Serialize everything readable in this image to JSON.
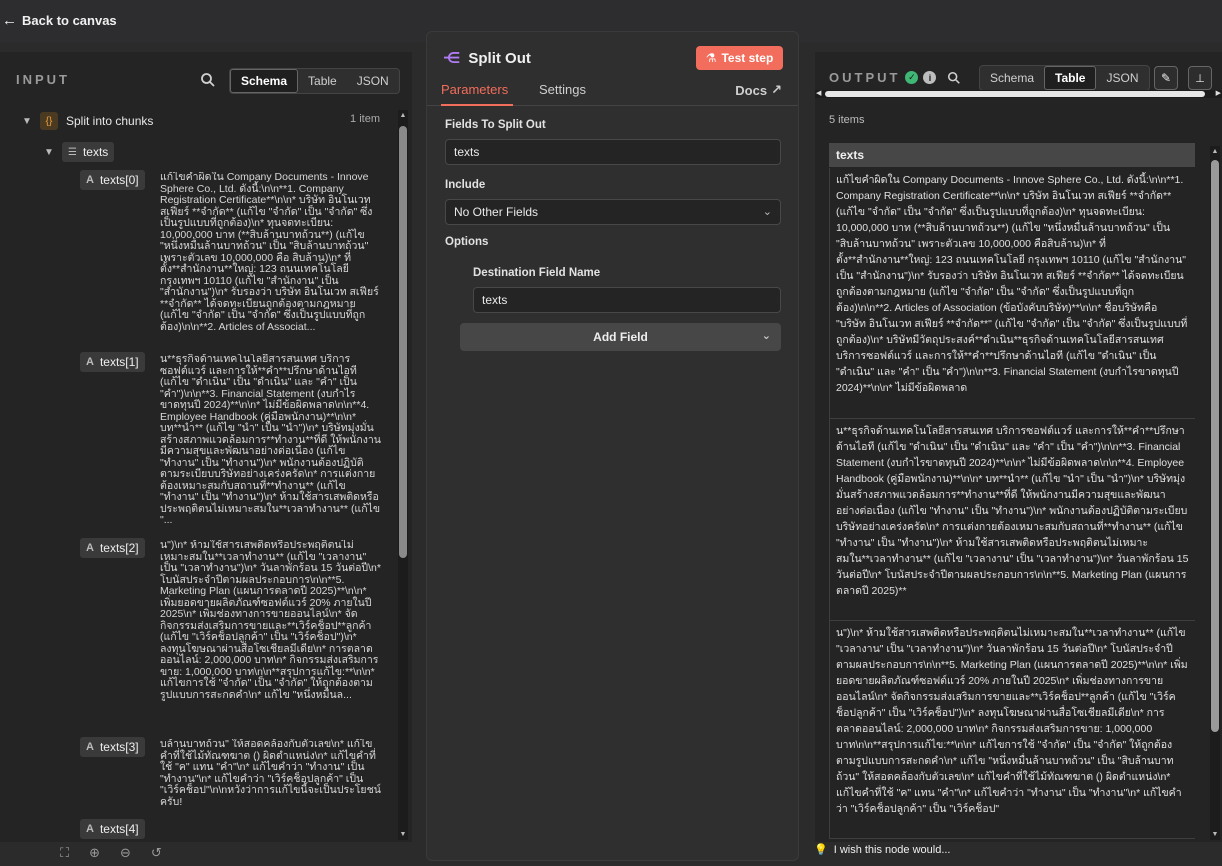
{
  "topbar": {
    "back_label": "Back to canvas"
  },
  "input": {
    "title": "INPUT",
    "views": [
      "Schema",
      "Table",
      "JSON"
    ],
    "active_view": "Schema",
    "root_label": "Split into chunks",
    "root_count": "1 item",
    "array_label": "texts",
    "entries": [
      {
        "key": "texts[0]",
        "value": "แก้ไขคำผิดใน Company Documents - Innove Sphere Co., Ltd. ดังนี้:\\n\\n**1. Company Registration Certificate**\\n\\n* บริษัท อินโนเวท สเฟียร์ **จำกัด** (แก้ไข \"จำกัด\" เป็น \"จำกัด\" ซึ่งเป็นรูปแบบที่ถูกต้อง)\\n* ทุนจดทะเบียน: 10,000,000 บาท (**สิบล้านบาทถ้วน**) (แก้ไข \"หนึ่งหมื่นล้านบาทถ้วน\" เป็น \"สิบล้านบาทถ้วน\" เพราะตัวเลข 10,000,000 คือ สิบล้าน)\\n* ที่ตั้ง**สำนักงาน**ใหญ่: 123 ถนนเทคโนโลยี กรุงเทพฯ 10110 (แก้ไข \"สำนักงาน\" เป็น \"สำนักงาน\")\\n* รับรองว่า บริษัท อินโนเวท สเฟียร์ **จำกัด** ได้จดทะเบียนถูกต้องตามกฎหมาย (แก้ไข \"จำกัด\" เป็น \"จำกัด\" ซึ่งเป็นรูปแบบที่ถูกต้อง)\\n\\n**2. Articles of Associat..."
      },
      {
        "key": "texts[1]",
        "value": "น**ธุรกิจด้านเทคโนโลยีสารสนเทศ บริการซอฟต์แวร์ และการให้**คำ**ปรึกษาด้านไอที (แก้ไข \"ดำเนิน\" เป็น \"ดำเนิน\" และ \"คำ\" เป็น \"คำ\")\\n\\n**3. Financial Statement (งบกำไรขาดทุนปี 2024)**\\n\\n* ไม่มีข้อผิดพลาด\\n\\n**4. Employee Handbook (คู่มือพนักงาน)**\\n\\n* บท**นำ** (แก้ไข \"นำ\" เป็น \"นำ\")\\n* บริษัทมุ่งมั่นสร้างสภาพแวดล้อมการ**ทำงาน**ที่ดี ให้พนักงานมีความสุขและพัฒนาอย่างต่อเนื่อง (แก้ไข \"ทำงาน\" เป็น \"ทำงาน\")\\n* พนักงานต้องปฏิบัติตามระเบียบบริษัทอย่างเคร่งครัด\\n* การแต่งกายต้องเหมาะสมกับสถานที่**ทำงาน** (แก้ไข \"ทำงาน\" เป็น \"ทำงาน\")\\n* ห้ามใช้สารเสพติดหรือประพฤติตนไม่เหมาะสมใน**เวลาทำงาน** (แก้ไข \"..."
      },
      {
        "key": "texts[2]",
        "value": "น\")\\n* ห้ามใช้สารเสพติดหรือประพฤติตนไม่เหมาะสมใน**เวลาทำงาน** (แก้ไข \"เวลางาน\" เป็น \"เวลาทำงาน\")\\n* วันลาพักร้อน 15 วันต่อปี\\n* โบนัสประจำปีตามผลประกอบการ\\n\\n**5. Marketing Plan (แผนการตลาดปี 2025)**\\n\\n* เพิ่มยอดขายผลิตภัณฑ์ซอฟต์แวร์ 20% ภายในปี 2025\\n* เพิ่มช่องทางการขายออนไลน์\\n* จัดกิจกรรมส่งเสริมการขายและ**เวิร์คช็อป**ลูกค้า (แก้ไข \"เวิร์คช็อปลูกค้า\" เป็น \"เวิร์คช็อป\")\\n* ลงทุนโฆษณาผ่านสื่อโซเชียลมีเดีย\\n* การตลาดออนไลน์: 2,000,000 บาท\\n* กิจกรรมส่งเสริมการขาย: 1,000,000 บาท\\n\\n**สรุปการแก้ไข:**\\n\\n* แก้ไขการใช้ \"จำกัด\" เป็น \"จำกัด\" ให้ถูกต้องตามรูปแบบการสะกดคำ\\n* แก้ไข \"หนึ่งหมื่นล..."
      },
      {
        "key": "texts[3]",
        "value": "บล้านบาทถ้วน\" ให้สอดคล้องกับตัวเลข\\n* แก้ไขคำที่ใช้ไม้ทัณฑฆาต (ฺ) ผิดตำแหน่ง\\n* แก้ไขคำที่ใช้ \"ค\" แทน \"คำ\"\\n* แก้ไขคำว่า \"ทำงาน\" เป็น \"ทำงาน\"\\n* แก้ไขคำว่า \"เวิร์คช็อปลูกค้า\" เป็น \"เวิร์คช็อป\"\\n\\nหวังว่าการแก้ไขนี้จะเป็นประโยชน์ครับ!"
      },
      {
        "key": "texts[4]",
        "value": ""
      }
    ]
  },
  "node": {
    "title": "Split Out",
    "test_label": "Test step",
    "tabs": [
      "Parameters",
      "Settings"
    ],
    "active_tab": "Parameters",
    "docs_label": "Docs",
    "fields_label": "Fields To Split Out",
    "fields_value": "texts",
    "include_label": "Include",
    "include_value": "No Other Fields",
    "options_label": "Options",
    "dest_label": "Destination Field Name",
    "dest_value": "texts",
    "add_field_label": "Add Field",
    "accent": "#f26d5b"
  },
  "output": {
    "title": "OUTPUT",
    "views": [
      "Schema",
      "Table",
      "JSON"
    ],
    "active_view": "Table",
    "items_count": "5 items",
    "column": "texts",
    "rows": [
      "แก้ไขคำผิดใน Company Documents - Innove Sphere Co., Ltd. ดังนี้:\\n\\n**1. Company Registration Certificate**\\n\\n* บริษัท อินโนเวท สเฟียร์ **จำกัด** (แก้ไข \"จำกัด\" เป็น \"จำกัด\" ซึ่งเป็นรูปแบบที่ถูกต้อง)\\n* ทุนจดทะเบียน: 10,000,000 บาท (**สิบล้านบาทถ้วน**) (แก้ไข \"หนึ่งหมื่นล้านบาทถ้วน\" เป็น \"สิบล้านบาทถ้วน\" เพราะตัวเลข 10,000,000 คือสิบล้าน)\\n* ที่ตั้ง**สำนักงาน**ใหญ่: 123 ถนนเทคโนโลยี กรุงเทพฯ 10110 (แก้ไข \"สำนักงาน\" เป็น \"สำนักงาน\")\\n* รับรองว่า บริษัท อินโนเวท สเฟียร์ **จำกัด** ได้จดทะเบียนถูกต้องตามกฎหมาย (แก้ไข \"จำกัด\" เป็น \"จำกัด\" ซึ่งเป็นรูปแบบที่ถูกต้อง)\\n\\n**2. Articles of Association (ข้อบังคับบริษัท)**\\n\\n* ชื่อบริษัทคือ \"บริษัท อินโนเวท สเฟียร์ **จำกัด**\" (แก้ไข \"จำกัด\" เป็น \"จำกัด\" ซึ่งเป็นรูปแบบที่ถูกต้อง)\\n* บริษัทมีวัตถุประสงค์**ดำเนิน**ธุรกิจด้านเทคโนโลยีสารสนเทศ บริการซอฟต์แวร์ และการให้**คำ**ปรึกษาด้านไอที (แก้ไข \"ดำเนิน\" เป็น \"ดำเนิน\" และ \"คำ\" เป็น \"คำ\")\\n\\n**3. Financial Statement (งบกำไรขาดทุนปี 2024)**\\n\\n* ไม่มีข้อผิดพลาด",
      "น**ธุรกิจด้านเทคโนโลยีสารสนเทศ บริการซอฟต์แวร์ และการให้**คำ**ปรึกษาด้านไอที (แก้ไข \"ดำเนิน\" เป็น \"ดำเนิน\" และ \"คำ\" เป็น \"คำ\")\\n\\n**3. Financial Statement (งบกำไรขาดทุนปี 2024)**\\n\\n* ไม่มีข้อผิดพลาด\\n\\n**4. Employee Handbook (คู่มือพนักงาน)**\\n\\n* บท**นำ** (แก้ไข \"นำ\" เป็น \"นำ\")\\n* บริษัทมุ่งมั่นสร้างสภาพแวดล้อมการ**ทำงาน**ที่ดี ให้พนักงานมีความสุขและพัฒนาอย่างต่อเนื่อง (แก้ไข \"ทำงาน\" เป็น \"ทำงาน\")\\n* พนักงานต้องปฏิบัติตามระเบียบบริษัทอย่างเคร่งครัด\\n* การแต่งกายต้องเหมาะสมกับสถานที่**ทำงาน** (แก้ไข \"ทำงาน\" เป็น \"ทำงาน\")\\n* ห้ามใช้สารเสพติดหรือประพฤติตนไม่เหมาะสมใน**เวลาทำงาน** (แก้ไข \"เวลางาน\" เป็น \"เวลาทำงาน\")\\n* วันลาพักร้อน 15 วันต่อปี\\n* โบนัสประจำปีตามผลประกอบการ\\n\\n**5. Marketing Plan (แผนการตลาดปี 2025)**",
      "น\")\\n* ห้ามใช้สารเสพติดหรือประพฤติตนไม่เหมาะสมใน**เวลาทำงาน** (แก้ไข \"เวลางาน\" เป็น \"เวลาทำงาน\")\\n* วันลาพักร้อน 15 วันต่อปี\\n* โบนัสประจำปีตามผลประกอบการ\\n\\n**5. Marketing Plan (แผนการตลาดปี 2025)**\\n\\n* เพิ่มยอดขายผลิตภัณฑ์ซอฟต์แวร์ 20% ภายในปี 2025\\n* เพิ่มช่องทางการขายออนไลน์\\n* จัดกิจกรรมส่งเสริมการขายและ**เวิร์คช็อป**ลูกค้า (แก้ไข \"เวิร์คช็อปลูกค้า\" เป็น \"เวิร์คช็อป\")\\n* ลงทุนโฆษณาผ่านสื่อโซเชียลมีเดีย\\n* การตลาดออนไลน์: 2,000,000 บาท\\n* กิจกรรมส่งเสริมการขาย: 1,000,000 บาท\\n\\n**สรุปการแก้ไข:**\\n\\n* แก้ไขการใช้ \"จำกัด\" เป็น \"จำกัด\" ให้ถูกต้องตามรูปแบบการสะกดคำ\\n* แก้ไข \"หนึ่งหมื่นล้านบาทถ้วน\" เป็น \"สิบล้านบาทถ้วน\" ให้สอดคล้องกับตัวเลข\\n* แก้ไขคำที่ใช้ไม้ทัณฑฆาต (ฺ) ผิดตำแหน่ง\\n* แก้ไขคำที่ใช้ \"ค\" แทน \"คำ\"\\n* แก้ไขคำว่า \"ทำงาน\" เป็น \"ทำงาน\"\\n* แก้ไขคำว่า \"เวิร์คช็อปลูกค้า\" เป็น \"เวิร์คช็อป\""
    ]
  },
  "footer": {
    "wish_label": "I wish this node would..."
  }
}
